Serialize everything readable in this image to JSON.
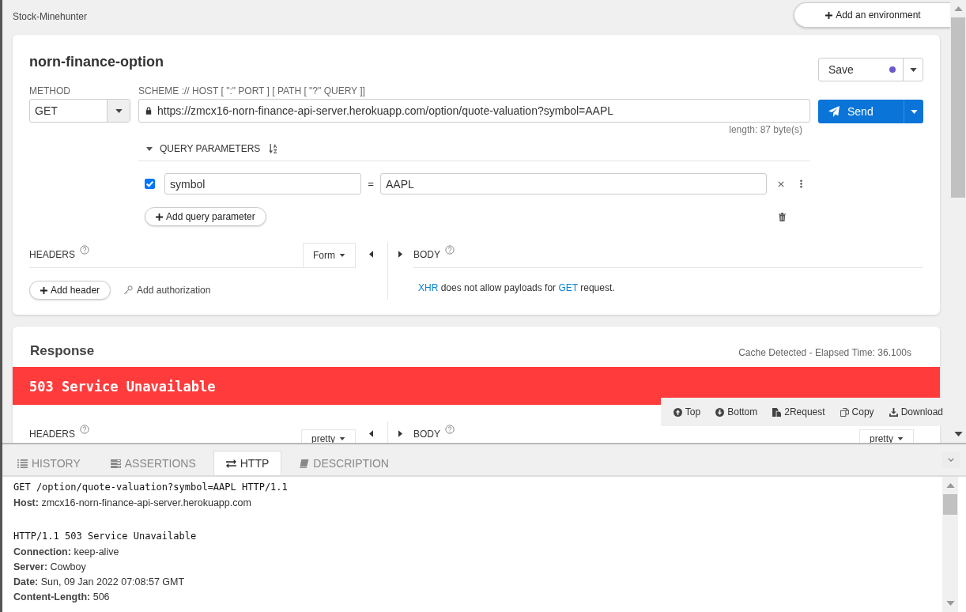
{
  "app_title": "Stock-Minehunter",
  "environment_button": "Add an environment",
  "request": {
    "name": "norn-finance-option",
    "save_button": "Save",
    "modified": true,
    "method_label": "METHOD",
    "method": "GET",
    "url_label": "SCHEME :// HOST [ \":\" PORT ] [ PATH [ \"?\" QUERY ]]",
    "url": "https://zmcx16-norn-finance-api-server.herokuapp.com/option/quote-valuation?symbol=AAPL",
    "url_length": "length: 87 byte(s)",
    "send_button": "Send",
    "query": {
      "title": "QUERY PARAMETERS",
      "expanded": true,
      "params": [
        {
          "name": "symbol",
          "operator": "=",
          "value": "AAPL",
          "checked": true
        }
      ],
      "add_button": "Add query parameter"
    },
    "headers": {
      "title": "HEADERS",
      "mode": "Form",
      "add_button": "Add header",
      "auth_link": "Add authorization"
    },
    "body": {
      "title": "BODY",
      "message": [
        {
          "kind": "link",
          "text": "XHR"
        },
        {
          "kind": "plain",
          "text": "does not allow payloads for"
        },
        {
          "kind": "link",
          "text": "GET"
        },
        {
          "kind": "plain",
          "text": "request."
        }
      ]
    }
  },
  "response": {
    "title": "Response",
    "timing": "Cache Detected - Elapsed Time: 36.100s",
    "status": "503 Service Unavailable",
    "toolbar": [
      {
        "kind": "top",
        "label": "Top"
      },
      {
        "kind": "bottom",
        "label": "Bottom"
      },
      {
        "kind": "request",
        "label": "2Request"
      },
      {
        "kind": "copy",
        "label": "Copy"
      },
      {
        "kind": "download",
        "label": "Download"
      }
    ],
    "headers": {
      "title": "HEADERS",
      "mode": "pretty"
    },
    "body": {
      "title": "BODY",
      "mode": "pretty"
    }
  },
  "bottom_panel": {
    "tabs": [
      {
        "kind": "history",
        "label": "HISTORY",
        "selected": false
      },
      {
        "kind": "assertions",
        "label": "ASSERTIONS",
        "selected": false
      },
      {
        "kind": "http",
        "label": "HTTP",
        "selected": true
      },
      {
        "kind": "description",
        "label": "DESCRIPTION",
        "selected": false
      }
    ],
    "lines": [
      {
        "kind": "start",
        "text": "GET /option/quote-valuation?symbol=AAPL HTTP/1.1"
      },
      {
        "kind": "header",
        "name": "Host:",
        "value": "zmcx16-norn-finance-api-server.herokuapp.com"
      },
      {
        "kind": "gap"
      },
      {
        "kind": "start",
        "text": "HTTP/1.1 503 Service Unavailable"
      },
      {
        "kind": "header",
        "name": "Connection:",
        "value": "keep-alive"
      },
      {
        "kind": "header",
        "name": "Server:",
        "value": "Cowboy"
      },
      {
        "kind": "header",
        "name": "Date:",
        "value": "Sun, 09 Jan 2022 07:08:57 GMT"
      },
      {
        "kind": "header",
        "name": "Content-Length:",
        "value": "506"
      }
    ]
  }
}
